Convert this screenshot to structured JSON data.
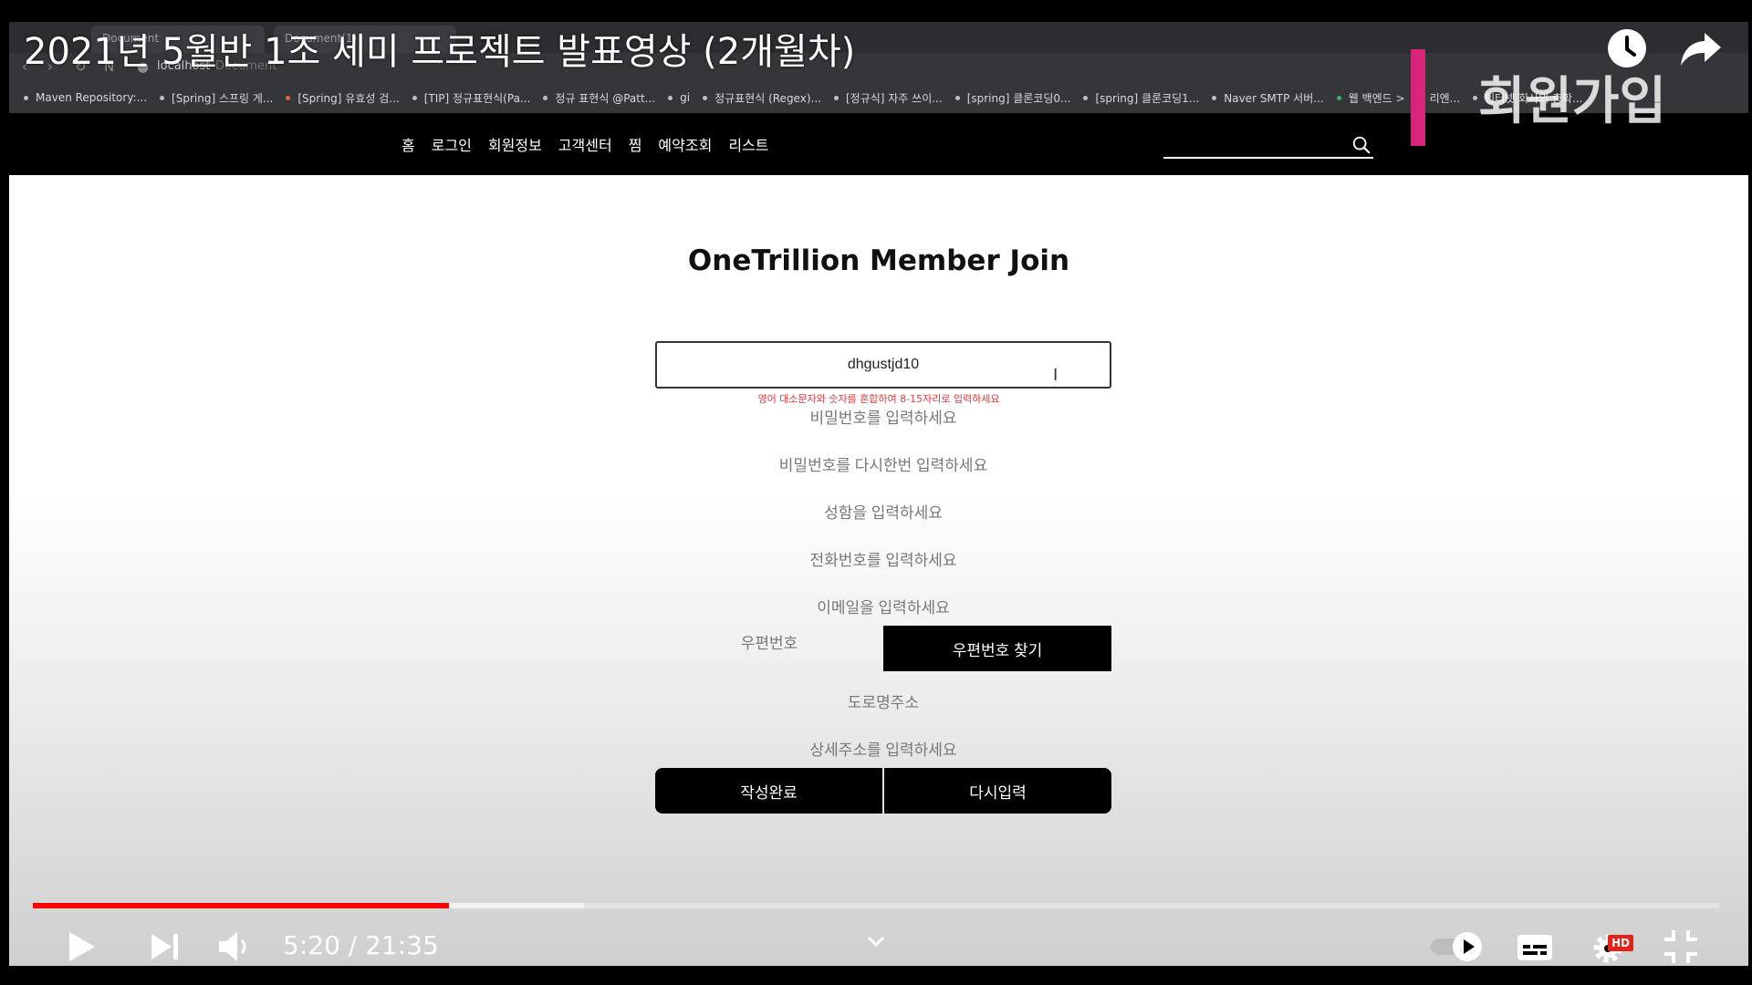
{
  "video_title": "2021년 5월반 1조 세미 프로젝트 발표영상 (2개월차)",
  "watermark": "회원가입",
  "browser": {
    "tabs": [
      "Document",
      "Document(1)"
    ],
    "url_host": "localhost",
    "url_title": "Document",
    "bookmarks": [
      "Maven Repository:...",
      "[Spring] 스프링 게...",
      "[Spring] 유효성 검...",
      "[TIP] 정규표현식(Pa...",
      "정규 표현식 @Patt...",
      "gi",
      "정규표현식 (Regex)...",
      "[정규식] 자주 쓰이...",
      "[spring] 클론코딩0...",
      "[spring] 클론코딩1...",
      "Naver SMTP 서버...",
      "웹 백엔드 >",
      "리엔...",
      "인터넷 회사의 충확..."
    ]
  },
  "site": {
    "menu": [
      "홈",
      "로그인",
      "회원정보",
      "고객센터",
      "찜",
      "예약조회",
      "리스트"
    ],
    "search_value": ""
  },
  "form": {
    "title": "OneTrillion Member Join",
    "id_value": "dhgustjd10",
    "id_hint": "영어 대소문자와 숫자를 혼합하여 8-15자리로 입력하세요",
    "password_placeholder": "비밀번호를 입력하세요",
    "password_confirm_placeholder": "비밀번호를 다시한번 입력하세요",
    "name_placeholder": "성함을 입력하세요",
    "phone_placeholder": "전화번호를 입력하세요",
    "email_placeholder": "이메일을 입력하세요",
    "zip_placeholder": "우편번호",
    "zip_button": "우편번호 찾기",
    "road_address_placeholder": "도로명주소",
    "detail_address_placeholder": "상세주소를 입력하세요",
    "submit_button": "작성완료",
    "reset_button": "다시입력"
  },
  "player": {
    "current_time": "5:20",
    "duration": "21:35",
    "time_text": "5:20 / 21:35",
    "played_fraction": 0.247,
    "buffered_fraction": 0.327,
    "hd_badge": "HD",
    "accent_color": "#ff0000"
  }
}
